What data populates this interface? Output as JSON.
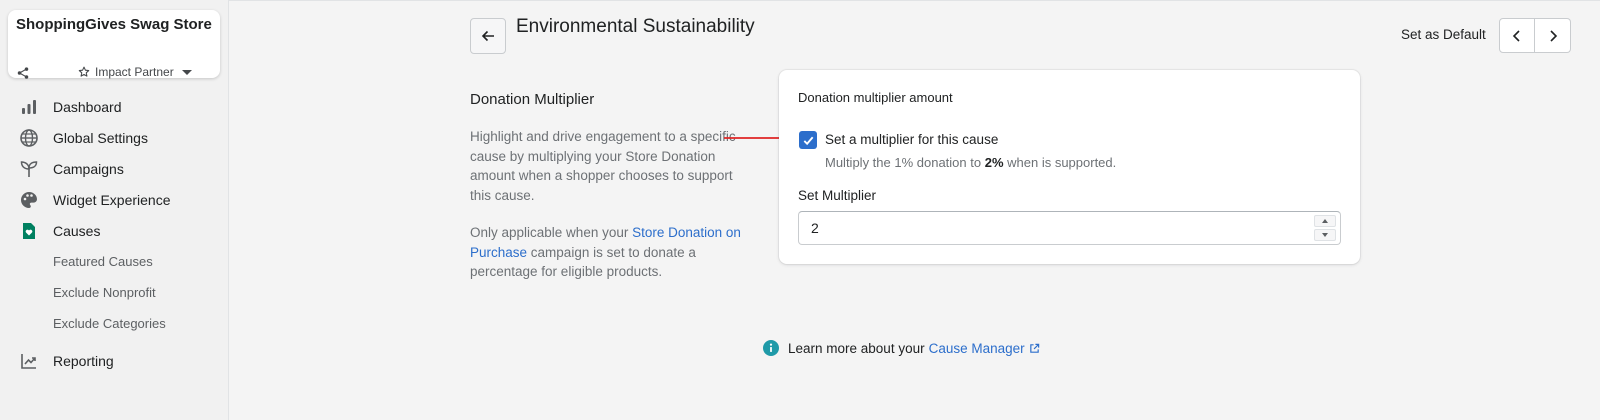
{
  "sidebar": {
    "store_name": "ShoppingGives Swag Store",
    "partner_label": "Impact Partner",
    "nav": [
      {
        "label": "Dashboard",
        "icon": "bar-chart-icon"
      },
      {
        "label": "Global Settings",
        "icon": "globe-icon"
      },
      {
        "label": "Campaigns",
        "icon": "sprout-icon"
      },
      {
        "label": "Widget Experience",
        "icon": "palette-icon"
      },
      {
        "label": "Causes",
        "icon": "heart-document-icon",
        "active": true
      }
    ],
    "sub_items": [
      "Featured Causes",
      "Exclude Nonprofit",
      "Exclude Categories"
    ],
    "reporting": {
      "label": "Reporting",
      "icon": "trending-report-icon"
    }
  },
  "header": {
    "title": "Environmental Sustainability",
    "set_default_label": "Set as Default"
  },
  "section": {
    "title": "Donation Multiplier",
    "description": "Highlight and drive engagement to a specific cause by multiplying your Store Donation amount when a shopper chooses to support this cause.",
    "note_prefix": "Only applicable when your ",
    "note_link": "Store Donation on Purchase",
    "note_suffix": " campaign is set to donate a percentage for eligible products."
  },
  "card": {
    "label": "Donation multiplier amount",
    "checkbox_label": "Set a multiplier for this cause",
    "checkbox_checked": true,
    "help_prefix": "Multiply the 1% donation to ",
    "help_bold": "2%",
    "help_suffix": " when is supported.",
    "field_label": "Set Multiplier",
    "field_value": "2"
  },
  "footer": {
    "learn_prefix": "Learn more about your ",
    "learn_link": "Cause Manager"
  },
  "colors": {
    "accent": "#2c6ecb",
    "brand_green": "#008060",
    "annotation_arrow": "#e02424"
  }
}
